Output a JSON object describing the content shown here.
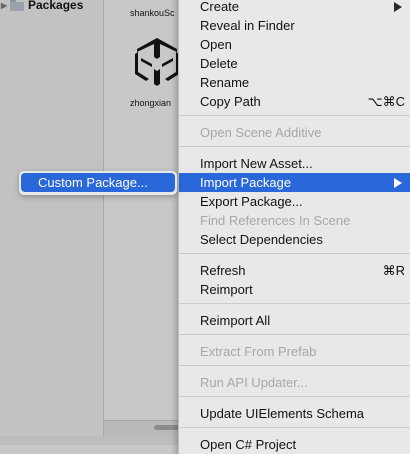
{
  "project_tree": {
    "items": [
      {
        "label": "Packages",
        "icon": "folder-icon"
      }
    ]
  },
  "assets": {
    "items": [
      {
        "label": "shankouSc"
      },
      {
        "label": "zhongxian"
      }
    ]
  },
  "context_menu": {
    "items": [
      {
        "label": "Create",
        "submenu": true,
        "disabled": false
      },
      {
        "label": "Reveal in Finder",
        "disabled": false
      },
      {
        "label": "Open",
        "disabled": false
      },
      {
        "label": "Delete",
        "disabled": false
      },
      {
        "label": "Rename",
        "disabled": false
      },
      {
        "label": "Copy Path",
        "shortcut": "⌥⌘C",
        "disabled": false
      },
      {
        "label": "Open Scene Additive",
        "disabled": true
      },
      {
        "label": "Import New Asset...",
        "disabled": false
      },
      {
        "label": "Import Package",
        "submenu": true,
        "highlighted": true
      },
      {
        "label": "Export Package...",
        "disabled": false
      },
      {
        "label": "Find References In Scene",
        "disabled": true
      },
      {
        "label": "Select Dependencies",
        "disabled": false
      },
      {
        "label": "Refresh",
        "shortcut": "⌘R",
        "disabled": false
      },
      {
        "label": "Reimport",
        "disabled": false
      },
      {
        "label": "Reimport All",
        "disabled": false
      },
      {
        "label": "Extract From Prefab",
        "disabled": true
      },
      {
        "label": "Run API Updater...",
        "disabled": true
      },
      {
        "label": "Update UIElements Schema",
        "disabled": false
      },
      {
        "label": "Open C# Project",
        "disabled": false
      }
    ]
  },
  "submenu": {
    "items": [
      {
        "label": "Custom Package...",
        "highlighted": true
      }
    ]
  },
  "colors": {
    "highlight": "#2a67d9",
    "menu_bg": "#e8e8e8",
    "disabled_text": "#a7a7a7"
  }
}
